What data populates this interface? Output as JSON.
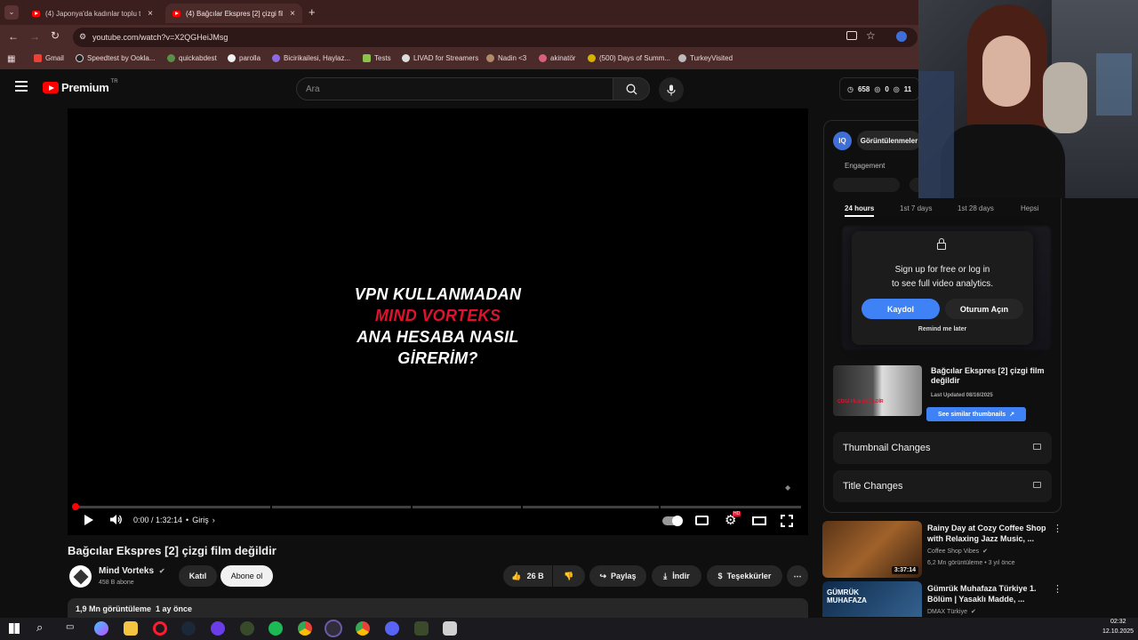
{
  "browser": {
    "tabs": [
      {
        "title": "(4) Japonya'da kadınlar toplu ta",
        "active": false
      },
      {
        "title": "(4) Bağcılar Ekspres [2] çizgi film",
        "active": true
      }
    ],
    "new_tab": "+",
    "url": "youtube.com/watch?v=X2QGHeiJMsg",
    "bookmarks": [
      "Gmail",
      "Speedtest by Ookla...",
      "quickabdest",
      "parolla",
      "Bicirikailesi, Haylaz...",
      "Tests",
      "LIVAD for Streamers",
      "Nadin <3",
      "akinatör",
      "(500) Days of Summ...",
      "TurkeyVisited"
    ]
  },
  "youtube": {
    "logo_text": "Premium",
    "logo_region": "TR",
    "search_placeholder": "Ara",
    "header_stats": {
      "views": "658",
      "likes": "0",
      "comments": "11"
    }
  },
  "video": {
    "overlay_lines": [
      "VPN KULLANMADAN",
      "MIND VORTEKS",
      "ANA HESABA NASIL",
      "GİRERİM?"
    ],
    "time": "0:00 / 1:32:14",
    "chapter": "Giriş",
    "title": "Bağcılar Ekspres [2] çizgi film değildir",
    "channel": "Mind Vorteks",
    "subscribers": "458 B abone",
    "join_label": "Katıl",
    "subscribe_label": "Abone ol",
    "likes": "26 B",
    "share_label": "Paylaş",
    "download_label": "İndir",
    "thanks_label": "Teşekkürler",
    "views_line": "1,9 Mn görüntüleme  1 ay önce",
    "progress_fraction": 0.0
  },
  "analytics": {
    "badge": "IQ",
    "views_tab": "Görüntülenmeler",
    "engagement_label": "Engagement",
    "time_tabs": [
      "24 hours",
      "1st 7 days",
      "1st 28 days",
      "Hepsi"
    ],
    "lock_message_1": "Sign up for free or log in",
    "lock_message_2": "to see full video analytics.",
    "signup_label": "Kaydol",
    "login_label": "Oturum Açın",
    "remind_label": "Remind me later",
    "thumb_title": "Bağcılar Ekspres [2] çizgi film değildir",
    "last_updated": "Last Updated 08/16/2025",
    "similar_label": "See similar thumbnails",
    "thumbnail_changes": "Thumbnail Changes",
    "title_changes": "Title Changes"
  },
  "recommendations": [
    {
      "title": "Rainy Day at Cozy Coffee Shop with Relaxing Jazz Music, ...",
      "channel": "Coffee Shop Vibes",
      "meta": "6,2 Mn görüntüleme • 3 yıl önce",
      "duration": "3:37:14"
    },
    {
      "title": "Gümrük Muhafaza Türkiye 1. Bölüm | Yasaklı Madde, ...",
      "channel": "DMAX Türkiye",
      "meta": "",
      "duration": ""
    }
  ],
  "taskbar": {
    "time": "02:32",
    "date": "12.10.2025"
  },
  "colors": {
    "accent_red": "#ff0000",
    "title_red": "#e0122d",
    "blue": "#3f82f5"
  }
}
